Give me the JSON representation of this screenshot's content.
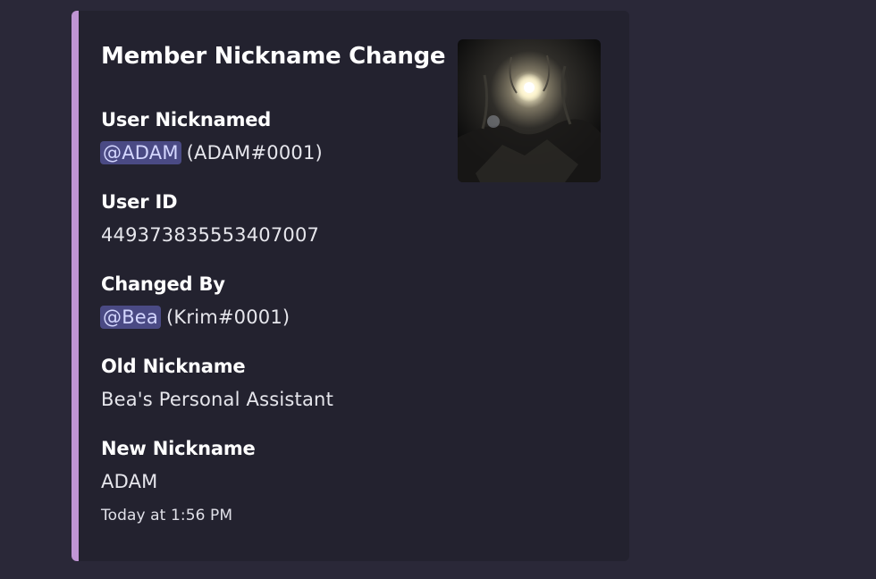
{
  "colors": {
    "accent": "#c095d4",
    "embed_bg": "#23222f",
    "page_bg": "#2a2838"
  },
  "embed": {
    "title": "Member Nickname Change",
    "fields": [
      {
        "name": "User Nicknamed",
        "mention": "@ADAM",
        "value": "(ADAM#0001)"
      },
      {
        "name": "User ID",
        "value": "449373835553407007"
      },
      {
        "name": "Changed By",
        "mention": "@Bea",
        "value": "(Krim#0001)"
      },
      {
        "name": "Old Nickname",
        "value": "Bea's Personal Assistant"
      },
      {
        "name": "New Nickname",
        "value": "ADAM"
      }
    ],
    "timestamp": "Today at 1:56 PM"
  }
}
